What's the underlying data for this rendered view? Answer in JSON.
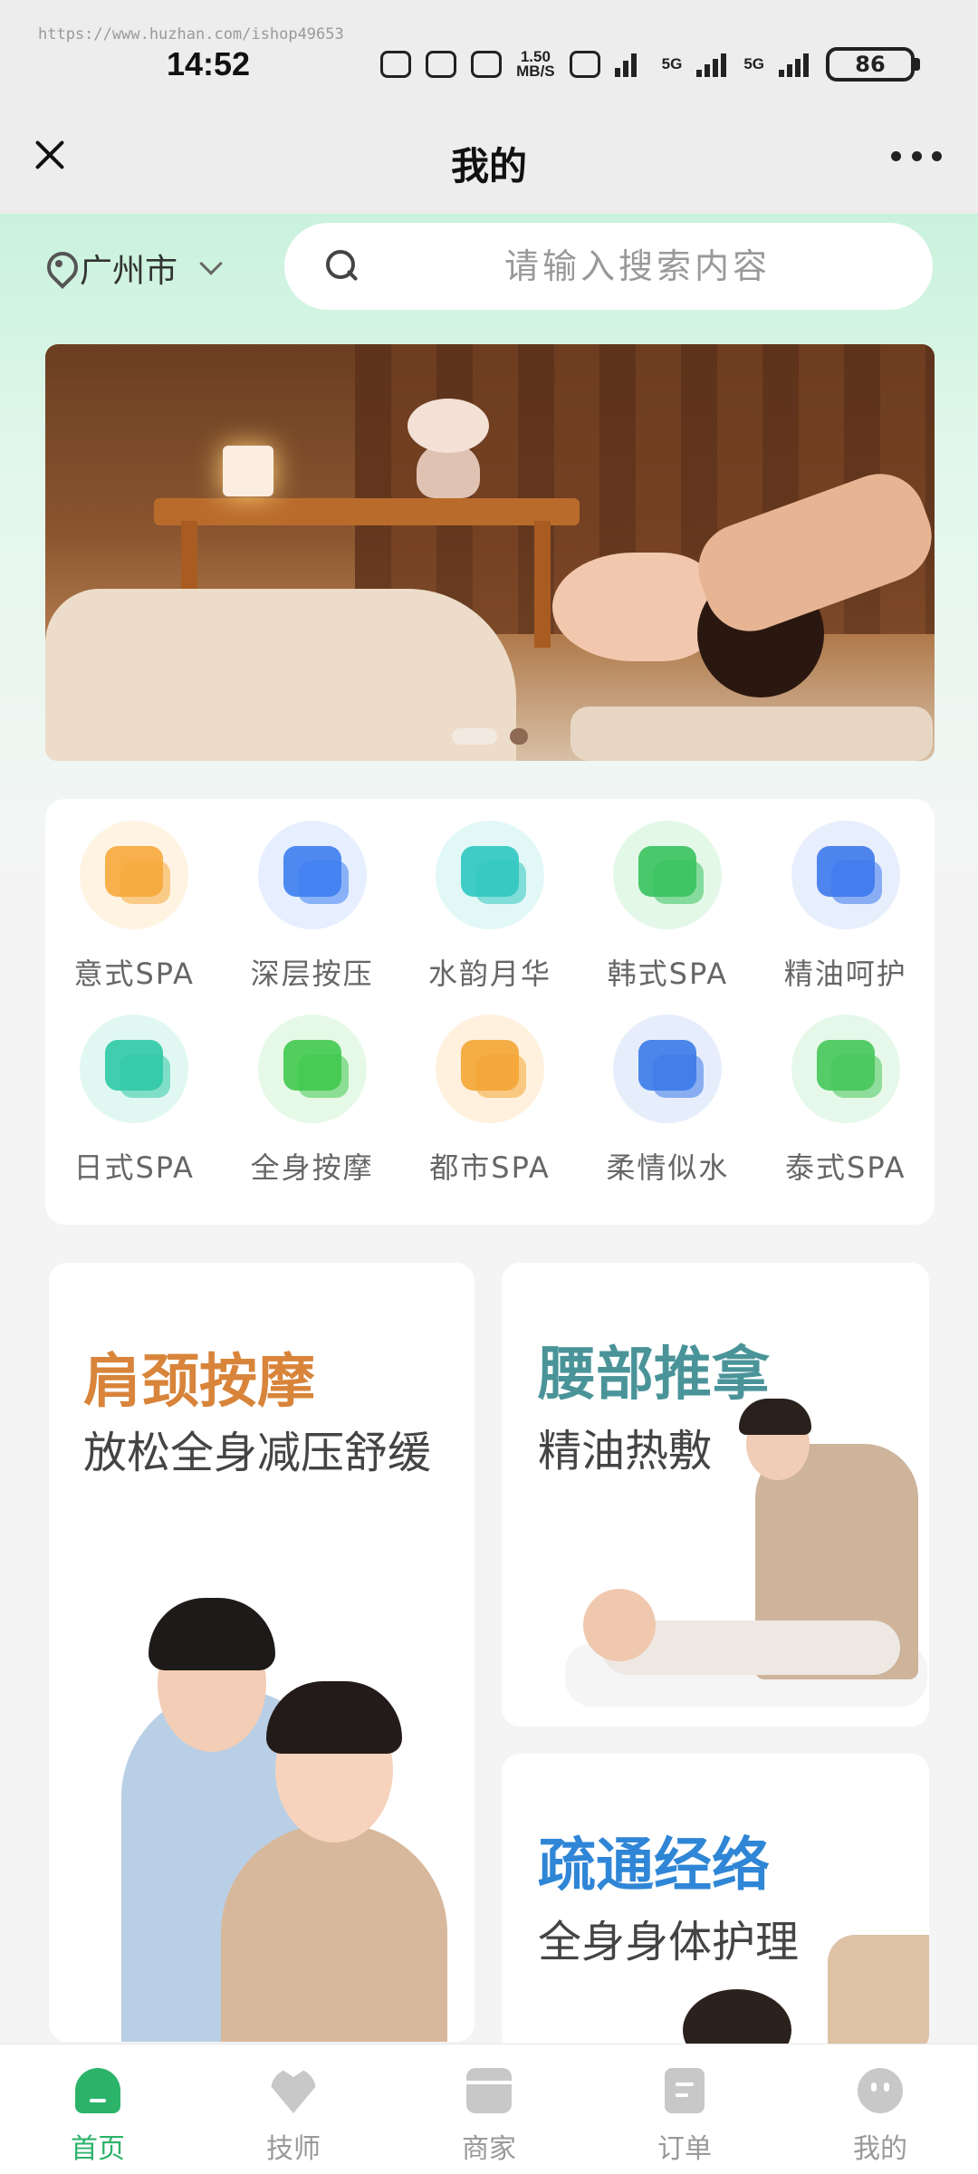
{
  "status_bar": {
    "watermark": "https://www.huzhan.com/ishop49653",
    "time": "14:52",
    "net_speed_value": "1.50",
    "net_speed_unit": "MB/S",
    "signal_tag_1": "5G",
    "signal_tag_2": "5G",
    "battery": "86"
  },
  "title_bar": {
    "title": "我的",
    "close_icon": "close-icon",
    "more_icon": "more-icon"
  },
  "header": {
    "city": "广州市",
    "search_placeholder": "请输入搜索内容"
  },
  "banner": {
    "slide_count": 2,
    "active_slide": 1
  },
  "categories": [
    {
      "label": "意式SPA",
      "color": "#f6a93b",
      "bg": "#fff3e2"
    },
    {
      "label": "深层按压",
      "color": "#3d7df0",
      "bg": "#e6efff"
    },
    {
      "label": "水韵月华",
      "color": "#2fc6c0",
      "bg": "#e2f8f7"
    },
    {
      "label": "韩式SPA",
      "color": "#37c25e",
      "bg": "#e4f8e8"
    },
    {
      "label": "精油呵护",
      "color": "#3d78ec",
      "bg": "#e7eefc"
    },
    {
      "label": "日式SPA",
      "color": "#2fc9a6",
      "bg": "#e1f8f2"
    },
    {
      "label": "全身按摩",
      "color": "#40c94e",
      "bg": "#e6f9e7"
    },
    {
      "label": "都市SPA",
      "color": "#f4a535",
      "bg": "#fff1de"
    },
    {
      "label": "柔情似水",
      "color": "#3b7ae8",
      "bg": "#e6eefc"
    },
    {
      "label": "泰式SPA",
      "color": "#45c65a",
      "bg": "#e6f8e9"
    }
  ],
  "promos": {
    "left": {
      "title": "肩颈按摩",
      "subtitle": "放松全身减压舒缓"
    },
    "right_top": {
      "title": "腰部推拿",
      "subtitle": "精油热敷"
    },
    "right_bottom": {
      "title": "疏通经络",
      "subtitle": "全身身体护理"
    }
  },
  "bottom_nav": [
    {
      "label": "首页",
      "icon": "home-icon",
      "active": true
    },
    {
      "label": "技师",
      "icon": "heart-icon",
      "active": false
    },
    {
      "label": "商家",
      "icon": "shop-icon",
      "active": false
    },
    {
      "label": "订单",
      "icon": "order-icon",
      "active": false
    },
    {
      "label": "我的",
      "icon": "user-icon",
      "active": false
    }
  ],
  "colors": {
    "accent": "#2cb36a",
    "hero_gradient_top": "#c9f2dc"
  }
}
